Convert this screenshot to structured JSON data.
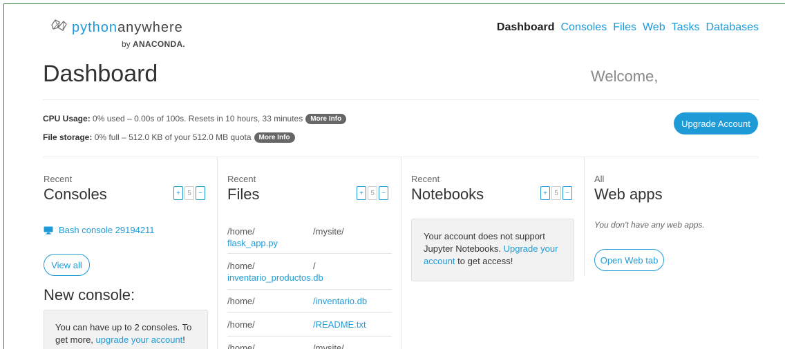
{
  "brand": {
    "name_python": "python",
    "name_anywhere": "anywhere",
    "by": "by",
    "company": "ANACONDA."
  },
  "nav": {
    "items": [
      {
        "label": "Dashboard",
        "active": true
      },
      {
        "label": "Consoles"
      },
      {
        "label": "Files"
      },
      {
        "label": "Web"
      },
      {
        "label": "Tasks"
      },
      {
        "label": "Databases"
      }
    ]
  },
  "page": {
    "title": "Dashboard",
    "welcome": "Welcome,"
  },
  "usage": {
    "cpu_label": "CPU Usage:",
    "cpu_text": "0% used – 0.00s of 100s. Resets in 10 hours, 33 minutes",
    "more_info": "More Info",
    "storage_label": "File storage:",
    "storage_text": "0% full – 512.0 KB of your 512.0 MB quota"
  },
  "upgrade_button": "Upgrade Account",
  "consoles": {
    "recent": "Recent",
    "title": "Consoles",
    "pager": [
      "+",
      "5",
      "−"
    ],
    "items": [
      "Bash console 29194211"
    ],
    "view_all": "View all",
    "new_console": "New console:",
    "limit_text": "You can have up to 2 consoles. To get more, ",
    "limit_link": "upgrade your account",
    "limit_end": "!"
  },
  "files": {
    "recent": "Recent",
    "title": "Files",
    "pager": [
      "+",
      "5",
      "−"
    ],
    "rows": [
      {
        "p1": "/home/",
        "p2": "/mysite/",
        "p2_blue": false,
        "name": "flask_app.py"
      },
      {
        "p1": "/home/",
        "p2": "/",
        "p2_blue": false,
        "name": "inventario_productos.db"
      },
      {
        "p1": "/home/",
        "p2": "/inventario.db",
        "p2_blue": true,
        "name": ""
      },
      {
        "p1": "/home/",
        "p2": "/README.txt",
        "p2_blue": true,
        "name": ""
      },
      {
        "p1": "/home/",
        "p2": "/mysite/",
        "p2_blue": false,
        "name": ""
      }
    ]
  },
  "notebooks": {
    "recent": "Recent",
    "title": "Notebooks",
    "pager": [
      "+",
      "5",
      "−"
    ],
    "msg_start": "Your account does not support Jupyter Notebooks. ",
    "msg_link": "Upgrade your account",
    "msg_end": " to get access!"
  },
  "webapps": {
    "recent": "All",
    "title": "Web apps",
    "none": "You don't have any web apps.",
    "open_button": "Open Web tab"
  }
}
